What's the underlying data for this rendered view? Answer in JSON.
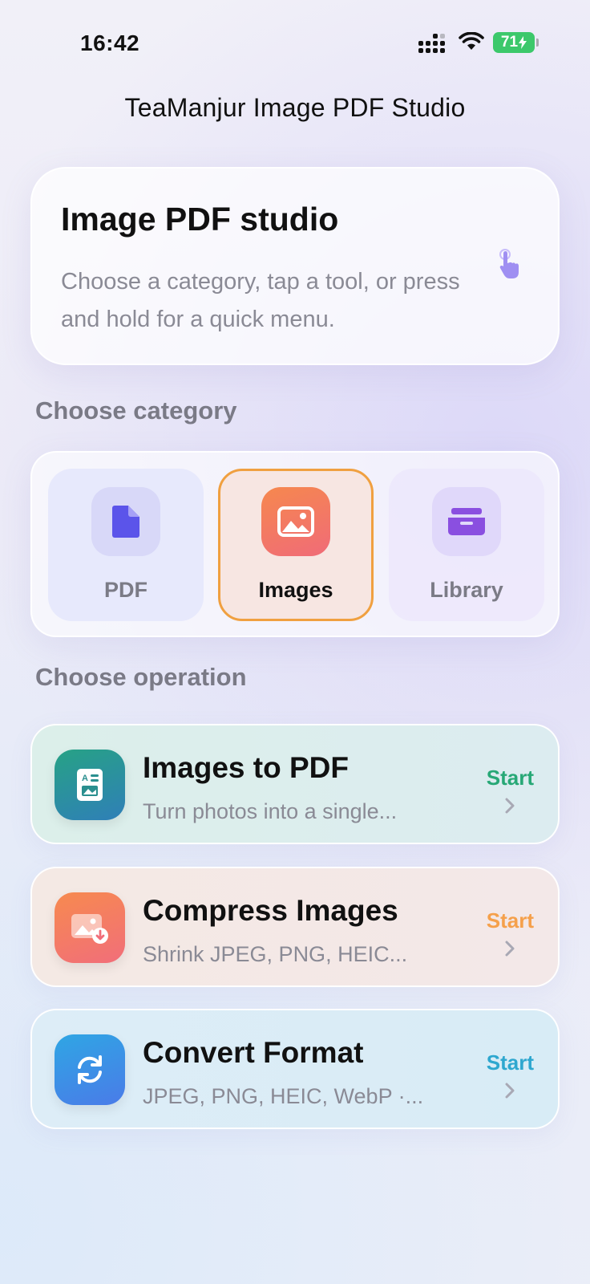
{
  "status_bar": {
    "time": "16:42",
    "battery": "71",
    "signal_icon": "cellular-signal-icon",
    "wifi_icon": "wifi-icon",
    "battery_color": "#3cc86b"
  },
  "app": {
    "title": "TeaManjur Image PDF Studio"
  },
  "hero": {
    "title": "Image PDF studio",
    "subtitle": "Choose a category, tap a tool, or press and hold for a quick menu.",
    "icon": "hand-tap-icon"
  },
  "categories": {
    "section_label": "Choose category",
    "items": [
      {
        "label": "PDF",
        "icon": "document-icon",
        "selected": false
      },
      {
        "label": "Images",
        "icon": "photo-icon",
        "selected": true
      },
      {
        "label": "Library",
        "icon": "tray-icon",
        "selected": false
      }
    ],
    "selected_color": "#f0a040"
  },
  "operations": {
    "section_label": "Choose operation",
    "items": [
      {
        "title": "Images to PDF",
        "subtitle": "Turn photos into a single...",
        "action": "Start",
        "icon": "image-document-icon",
        "accent": "#27a876"
      },
      {
        "title": "Compress Images",
        "subtitle": "Shrink JPEG, PNG, HEIC...",
        "action": "Start",
        "icon": "image-compress-icon",
        "accent": "#f5a04b"
      },
      {
        "title": "Convert Format",
        "subtitle": "JPEG, PNG, HEIC, WebP ·...",
        "action": "Start",
        "icon": "convert-arrows-icon",
        "accent": "#2ea7cf"
      }
    ]
  }
}
